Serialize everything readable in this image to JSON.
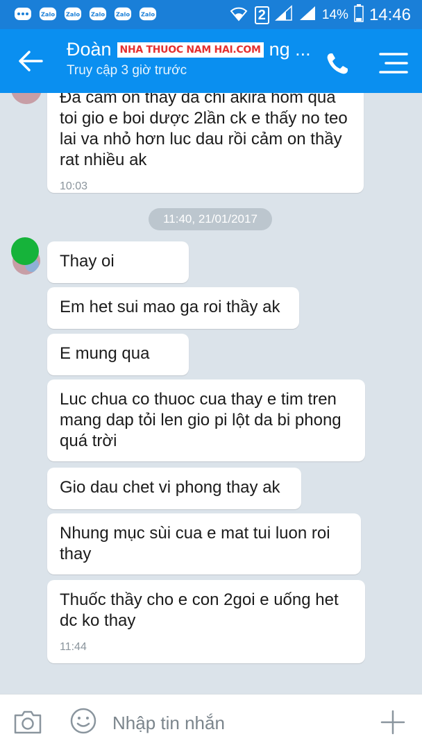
{
  "status_bar": {
    "notification_icons": [
      "Zalo",
      "Zalo",
      "Zalo",
      "Zalo",
      "Zalo"
    ],
    "sim_label": "2",
    "battery": "14%",
    "time": "14:46"
  },
  "header": {
    "name_start": "Đoàn",
    "watermark": "NHA THUOC NAM HAI.COM",
    "name_end": "ng ...",
    "last_seen": "Truy cập 3 giờ trước"
  },
  "messages": {
    "m1_partial": "Đa cam on thay đa chi akira hom qua",
    "m1_text": "toi gio e boi dược 2lần ck e thấy no teo lai va nhỏ hơn luc dau rồi cảm on thầy rat nhiều ak",
    "m1_time": "10:03",
    "date_divider": "11:40, 21/01/2017",
    "m2": "Thay oi",
    "m3": "Em het sui mao ga roi thầy ak",
    "m4": "E mung qua",
    "m5": "Luc chua co thuoc cua thay e tim tren mang dap tỏi len gio pi lột da bi phong quá trời",
    "m6": "Gio dau chet vi phong thay ak",
    "m7": "Nhung mục sùi cua e mat tui luon roi thay",
    "m8": "Thuốc thầy cho e con 2goi e uống het dc ko thay",
    "m8_time": "11:44"
  },
  "input": {
    "placeholder": "Nhập tin nhắn"
  },
  "colors": {
    "header_bg": "#0a8ff0",
    "status_bg": "#1a7fd8",
    "chat_bg": "#dbe3ea",
    "bubble_bg": "#ffffff",
    "avatar_green": "#16b33a"
  },
  "icons": [
    "back-arrow-icon",
    "phone-icon",
    "menu-icon",
    "camera-icon",
    "emoji-icon",
    "plus-icon"
  ]
}
